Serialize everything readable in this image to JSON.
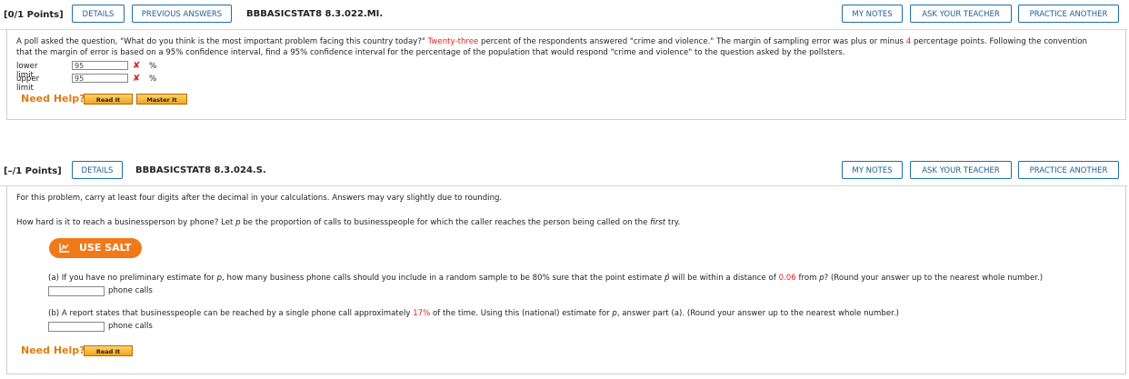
{
  "q1": {
    "points": "[0/1 Points]",
    "details": "DETAILS",
    "previous": "PREVIOUS ANSWERS",
    "id": "BBBASICSTAT8 8.3.022.MI.",
    "my_notes": "MY NOTES",
    "ask_teacher": "ASK YOUR TEACHER",
    "practice": "PRACTICE ANOTHER",
    "text_a": "A poll asked the question, \"What do you think is the most important problem facing this country today?\" ",
    "text_red1": "Twenty-three",
    "text_b": " percent of the respondents answered \"crime and violence.\" The margin of sampling error was plus or minus ",
    "text_red2": "4",
    "text_c": " percentage points. Following the convention",
    "text_line2": "that the margin of error is based on a 95% confidence interval, find a 95% confidence interval for the percentage of the population that would respond \"crime and violence\" to the question asked by the pollsters.",
    "lower_label": "lower limit",
    "lower_value": "95",
    "upper_label": "upper limit",
    "upper_value": "95",
    "unit": "%",
    "need_help": "Need Help?",
    "read_it": "Read It",
    "master_it": "Master It"
  },
  "q2": {
    "points": "[–/1 Points]",
    "details": "DETAILS",
    "id": "BBBASICSTAT8 8.3.024.S.",
    "my_notes": "MY NOTES",
    "ask_teacher": "ASK YOUR TEACHER",
    "practice": "PRACTICE ANOTHER",
    "instr": "For this problem, carry at least four digits after the decimal in your calculations. Answers may vary slightly due to rounding.",
    "question_a": "How hard is it to reach a businessperson by phone? Let ",
    "question_p": "p",
    "question_b": " be the proportion of calls to businesspeople for which the caller reaches the person being called on the ",
    "question_first": "first",
    "question_c": " try.",
    "use_salt": "USE SALT",
    "part_a_1": "(a) If you have no preliminary estimate for ",
    "part_a_p": "p",
    "part_a_2": ", how many business phone calls should you include in a random sample to be 80% sure that the point estimate ",
    "part_a_phat": "p̂",
    "part_a_3": " will be within a distance of ",
    "part_a_red": "0.06",
    "part_a_4": " from ",
    "part_a_p2": "p",
    "part_a_5": "? (Round your answer up to the nearest whole number.)",
    "part_a_unit": "phone calls",
    "part_b_1": "(b) A report states that businesspeople can be reached by a single phone call approximately ",
    "part_b_red": "17%",
    "part_b_2": " of the time. Using this (national) estimate for ",
    "part_b_p": "p",
    "part_b_3": ", answer part (a). (Round your answer up to the nearest whole number.)",
    "part_b_unit": "phone calls",
    "need_help": "Need Help?",
    "read_it": "Read It"
  }
}
